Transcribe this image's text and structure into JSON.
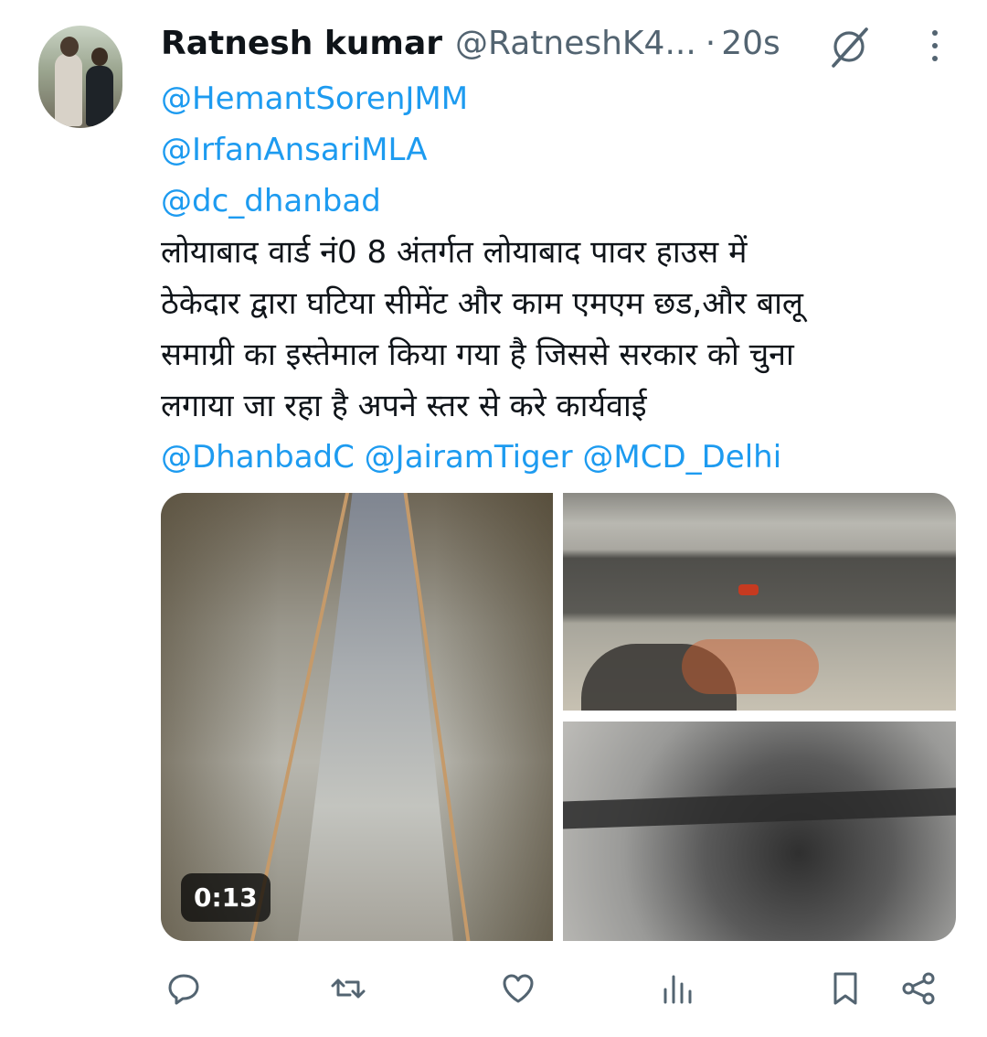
{
  "author": {
    "name": "Ratnesh kumar",
    "handle": "@RatneshK4...",
    "separator": "·",
    "time": "20s"
  },
  "tweet": {
    "mentions_top": [
      "@HemantSorenJMM",
      "@IrfanAnsariMLA",
      "@dc_dhanbad"
    ],
    "text_lines": [
      "लोयाबाद वार्ड नं0 8 अंतर्गत लोयाबाद पावर हाउस में",
      "ठेकेदार द्वारा घटिया सीमेंट और काम एमएम छड,और बालू",
      "समाग्री का इस्तेमाल किया गया है जिससे सरकार को चुना",
      "लगाया जा रहा है अपने स्तर से करे कार्यवाई"
    ],
    "mentions_bottom": [
      "@DhanbadC",
      "@JairamTiger",
      "@MCD_Delhi"
    ]
  },
  "media": {
    "video_duration": "0:13"
  },
  "icons": {
    "grok": "grok-icon",
    "more": "more-vertical-icon",
    "reply": "reply-icon",
    "repost": "repost-icon",
    "like": "like-icon",
    "views": "views-icon",
    "bookmark": "bookmark-icon",
    "share": "share-icon"
  },
  "colors": {
    "link": "#1d9bf0",
    "secondary_text": "#536471",
    "primary_text": "#0f1419"
  }
}
